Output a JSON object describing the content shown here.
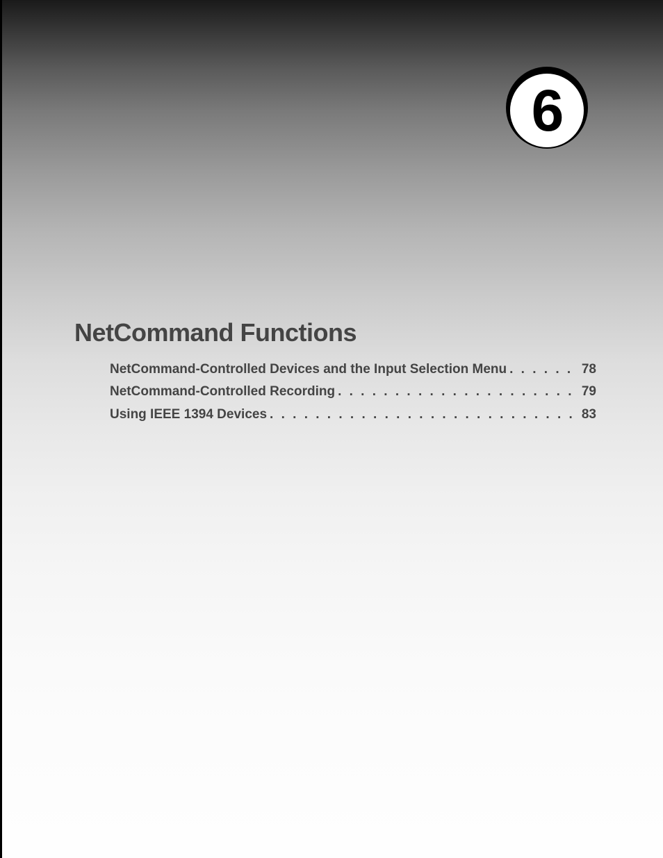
{
  "chapter": {
    "number": "6",
    "title": "NetCommand Functions"
  },
  "toc": {
    "entries": [
      {
        "title": "NetCommand-Controlled Devices and the Input Selection Menu",
        "page": "78"
      },
      {
        "title": "NetCommand-Controlled Recording",
        "page": "79"
      },
      {
        "title": "Using IEEE 1394 Devices",
        "page": "83"
      }
    ]
  }
}
